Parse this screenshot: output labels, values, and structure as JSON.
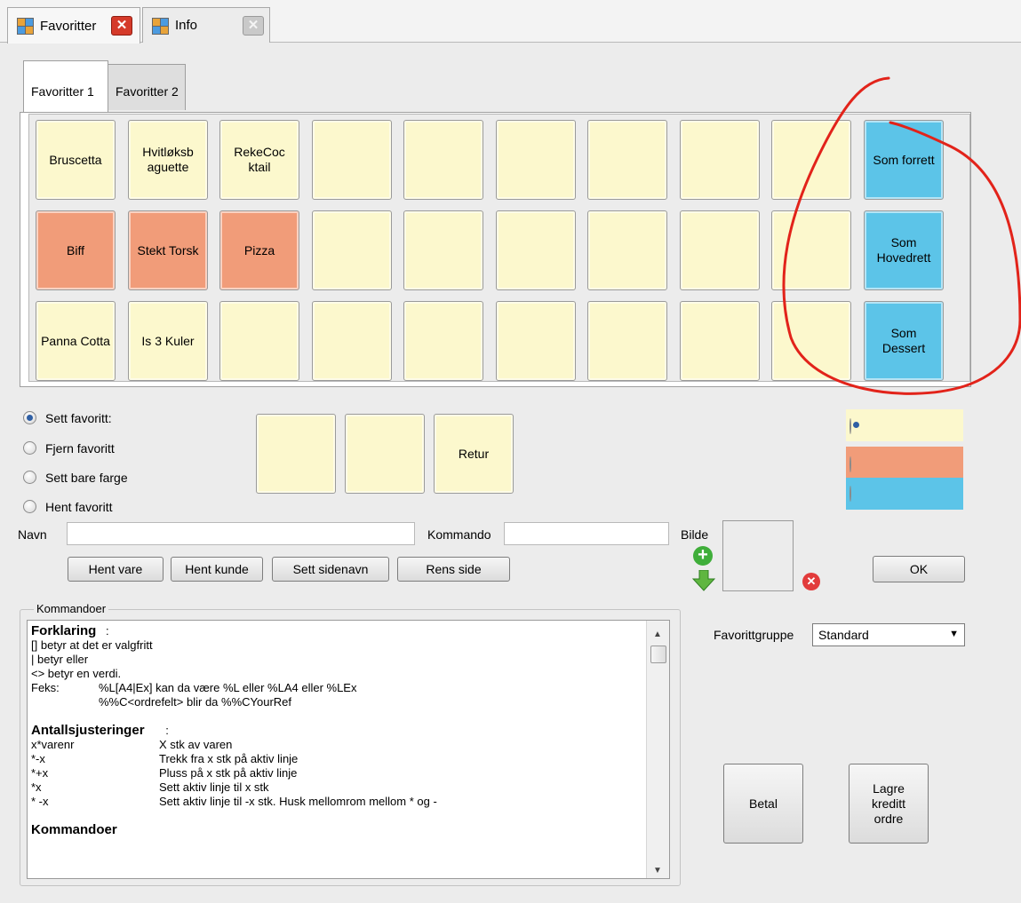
{
  "doc_tabs": [
    {
      "label": "Favoritter",
      "close": "✕"
    },
    {
      "label": "Info",
      "close": "✕"
    }
  ],
  "inner_tabs": [
    "Favoritter 1",
    "Favoritter 2"
  ],
  "grid": {
    "rows": [
      [
        {
          "label": "Bruscetta",
          "color": "#fcf8cd"
        },
        {
          "label": "Hvitløksb aguette",
          "color": "#fcf8cd"
        },
        {
          "label": "RekeCoc ktail",
          "color": "#fcf8cd"
        },
        {
          "label": "",
          "color": "#fcf8cd"
        },
        {
          "label": "",
          "color": "#fcf8cd"
        },
        {
          "label": "",
          "color": "#fcf8cd"
        },
        {
          "label": "",
          "color": "#fcf8cd"
        },
        {
          "label": "",
          "color": "#fcf8cd"
        },
        {
          "label": "",
          "color": "#fcf8cd"
        },
        {
          "label": "Som forrett",
          "color": "#5cc4e8"
        }
      ],
      [
        {
          "label": "Biff",
          "color": "#f19c79"
        },
        {
          "label": "Stekt Torsk",
          "color": "#f19c79"
        },
        {
          "label": "Pizza",
          "color": "#f19c79"
        },
        {
          "label": "",
          "color": "#fcf8cd"
        },
        {
          "label": "",
          "color": "#fcf8cd"
        },
        {
          "label": "",
          "color": "#fcf8cd"
        },
        {
          "label": "",
          "color": "#fcf8cd"
        },
        {
          "label": "",
          "color": "#fcf8cd"
        },
        {
          "label": "",
          "color": "#fcf8cd"
        },
        {
          "label": "Som Hovedrett",
          "color": "#5cc4e8"
        }
      ],
      [
        {
          "label": "Panna Cotta",
          "color": "#fcf8cd"
        },
        {
          "label": "Is 3 Kuler",
          "color": "#fcf8cd"
        },
        {
          "label": "",
          "color": "#fcf8cd"
        },
        {
          "label": "",
          "color": "#fcf8cd"
        },
        {
          "label": "",
          "color": "#fcf8cd"
        },
        {
          "label": "",
          "color": "#fcf8cd"
        },
        {
          "label": "",
          "color": "#fcf8cd"
        },
        {
          "label": "",
          "color": "#fcf8cd"
        },
        {
          "label": "",
          "color": "#fcf8cd"
        },
        {
          "label": "Som Dessert",
          "color": "#5cc4e8"
        }
      ]
    ]
  },
  "mode_options": [
    {
      "label": "Sett favoritt:",
      "selected": true
    },
    {
      "label": "Fjern favoritt",
      "selected": false
    },
    {
      "label": "Sett bare farge",
      "selected": false
    },
    {
      "label": "Hent favoritt",
      "selected": false
    }
  ],
  "nav_buttons": [
    "",
    "",
    "Retur"
  ],
  "color_options": [
    {
      "color": "#fcf8cd",
      "selected": true
    },
    {
      "color": "#f19c79",
      "selected": false
    },
    {
      "color": "#5cc4e8",
      "selected": false
    }
  ],
  "form": {
    "navn_label": "Navn",
    "navn_value": "",
    "kommando_label": "Kommando",
    "kommando_value": "",
    "bilde_label": "Bilde"
  },
  "action_buttons": [
    "Hent vare",
    "Hent kunde",
    "Sett sidenavn",
    "Rens side"
  ],
  "ok_label": "OK",
  "commands": {
    "group_label": "Kommandoer",
    "lines": [
      {
        "text": "Forklaring",
        "after": ":",
        "bold": true
      },
      {
        "text": "[] betyr at det er valgfritt"
      },
      {
        "text": "| betyr eller"
      },
      {
        "text": "<> betyr en verdi."
      },
      {
        "text": "Feks:",
        "col2": "%L[A4|Ex] kan da være %L eller %LA4 eller %LEx"
      },
      {
        "text": "",
        "col2": "%%C<ordrefelt> blir da %%CYourRef"
      },
      {
        "text": ""
      },
      {
        "text": "Antallsjusteringer",
        "after": ":",
        "bold": true
      },
      {
        "text": "x*varenr",
        "col3": "X stk av varen"
      },
      {
        "text": "*-x",
        "col3": "Trekk fra x stk på aktiv linje"
      },
      {
        "text": "*+x",
        "col3": "Pluss på x stk på aktiv linje"
      },
      {
        "text": "*x",
        "col3": "Sett aktiv linje til x stk"
      },
      {
        "text": "* -x",
        "col3": "Sett aktiv linje til -x stk. Husk mellomrom mellom * og -"
      },
      {
        "text": ""
      },
      {
        "text": "Kommandoer",
        "after": ":",
        "bold": true
      }
    ]
  },
  "favorittgruppe": {
    "label": "Favorittgruppe",
    "value": "Standard"
  },
  "bottom_buttons": [
    "Betal",
    "Lagre kreditt ordre"
  ],
  "annotation_color": "#e2231a"
}
